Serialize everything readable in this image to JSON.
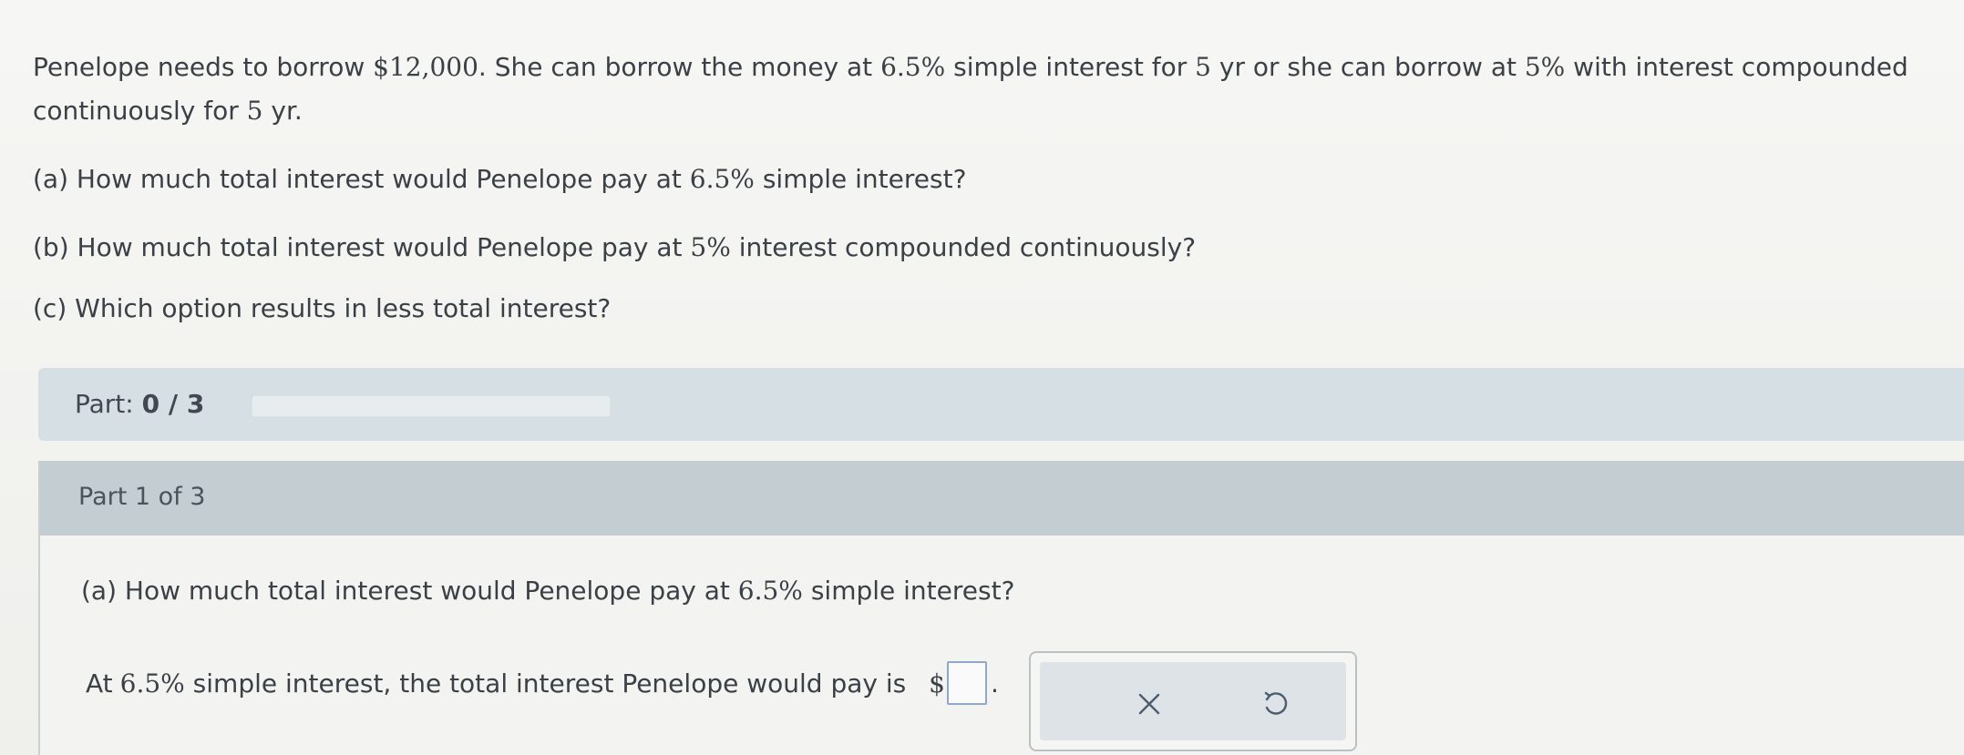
{
  "problem": {
    "intro_1": "Penelope needs to borrow ",
    "amount": "$12,000",
    "intro_2": ". She can borrow the money at ",
    "rate_simple": "6.5%",
    "intro_3": " simple interest for ",
    "years_1": "5",
    "intro_4": " yr or she can borrow at ",
    "rate_cont": "5%",
    "intro_5": " with interest compounded continuously for ",
    "years_2": "5",
    "intro_6": " yr."
  },
  "questions": {
    "a_prefix": "(a) How much total interest would Penelope pay at ",
    "a_rate": "6.5%",
    "a_suffix": " simple interest?",
    "b_prefix": "(b) How much total interest would Penelope pay at ",
    "b_rate": "5%",
    "b_suffix": " interest compounded continuously?",
    "c": "(c) Which option results in less total interest?"
  },
  "progress": {
    "label": "Part: ",
    "value": "0 / 3",
    "fraction": 0
  },
  "part": {
    "header": "Part 1 of 3",
    "question_prefix": "(a) How much total interest would Penelope pay at ",
    "question_rate": "6.5%",
    "question_suffix": " simple interest?",
    "answer_prefix": "At ",
    "answer_rate": "6.5%",
    "answer_middle": " simple interest, the total interest Penelope would pay is ",
    "answer_dollar": "$",
    "answer_value": "",
    "answer_period": "."
  },
  "actions": {
    "clear_icon": "x-icon",
    "undo_icon": "undo-icon"
  }
}
